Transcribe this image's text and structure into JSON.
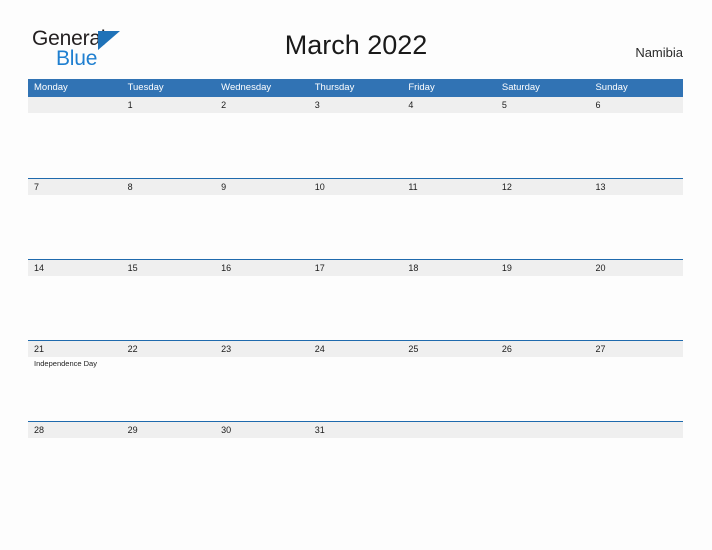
{
  "brand": {
    "line1": "General",
    "line2": "Blue",
    "flag_icon": "blue-triangle-flag-icon",
    "color_dark": "#231f20",
    "color_blue": "#1f7fd0"
  },
  "header": {
    "title": "March 2022",
    "region": "Namibia"
  },
  "theme": {
    "header_blue": "#3173b4",
    "row_line_blue": "#1f6aad",
    "day_band_gray": "#efefef",
    "page_background": "#fdfdfd"
  },
  "calendar": {
    "month": "March",
    "year": "2022",
    "weekday_headers": [
      "Monday",
      "Tuesday",
      "Wednesday",
      "Thursday",
      "Friday",
      "Saturday",
      "Sunday"
    ],
    "weeks": [
      [
        {
          "number": "",
          "events": []
        },
        {
          "number": "1",
          "events": []
        },
        {
          "number": "2",
          "events": []
        },
        {
          "number": "3",
          "events": []
        },
        {
          "number": "4",
          "events": []
        },
        {
          "number": "5",
          "events": []
        },
        {
          "number": "6",
          "events": []
        }
      ],
      [
        {
          "number": "7",
          "events": []
        },
        {
          "number": "8",
          "events": []
        },
        {
          "number": "9",
          "events": []
        },
        {
          "number": "10",
          "events": []
        },
        {
          "number": "11",
          "events": []
        },
        {
          "number": "12",
          "events": []
        },
        {
          "number": "13",
          "events": []
        }
      ],
      [
        {
          "number": "14",
          "events": []
        },
        {
          "number": "15",
          "events": []
        },
        {
          "number": "16",
          "events": []
        },
        {
          "number": "17",
          "events": []
        },
        {
          "number": "18",
          "events": []
        },
        {
          "number": "19",
          "events": []
        },
        {
          "number": "20",
          "events": []
        }
      ],
      [
        {
          "number": "21",
          "events": [
            "Independence Day"
          ]
        },
        {
          "number": "22",
          "events": []
        },
        {
          "number": "23",
          "events": []
        },
        {
          "number": "24",
          "events": []
        },
        {
          "number": "25",
          "events": []
        },
        {
          "number": "26",
          "events": []
        },
        {
          "number": "27",
          "events": []
        }
      ],
      [
        {
          "number": "28",
          "events": []
        },
        {
          "number": "29",
          "events": []
        },
        {
          "number": "30",
          "events": []
        },
        {
          "number": "31",
          "events": []
        },
        {
          "number": "",
          "events": []
        },
        {
          "number": "",
          "events": []
        },
        {
          "number": "",
          "events": []
        }
      ]
    ]
  }
}
